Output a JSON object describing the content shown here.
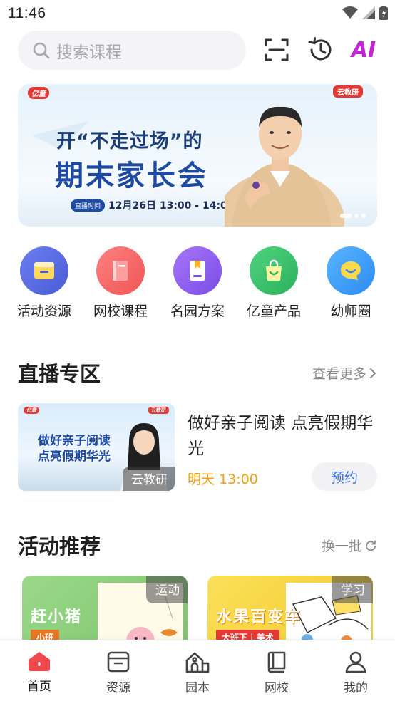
{
  "status_bar": {
    "time": "11:46"
  },
  "search": {
    "placeholder": "搜索课程"
  },
  "header": {
    "ai_label": "AI"
  },
  "banner": {
    "brand_left": "亿童",
    "brand_right": "云教研",
    "line1": "开“不走过场”的",
    "line2": "期末家长会",
    "live_tag": "直播时间",
    "live_time": "12月26日 13:00 - 14:00"
  },
  "quick_menu": [
    {
      "label": "活动资源",
      "color": "#5b6ee1",
      "icon": "folder-icon"
    },
    {
      "label": "网校课程",
      "color": "#f26b6b",
      "icon": "book-icon"
    },
    {
      "label": "名园方案",
      "color": "#8b5cf6",
      "icon": "bookmark-icon"
    },
    {
      "label": "亿童产品",
      "color": "#34c36a",
      "icon": "shopping-bag-icon"
    },
    {
      "label": "幼师圈",
      "color": "#3b9ff5",
      "icon": "chat-bubble-icon"
    }
  ],
  "live_section": {
    "title": "直播专区",
    "more": "查看更多",
    "item": {
      "thumb_brand_left": "亿童",
      "thumb_brand_right": "云教研",
      "thumb_line1": "做好亲子阅读",
      "thumb_line2": "点亮假期华光",
      "thumb_badge": "云教研",
      "title": "做好亲子阅读 点亮假期华光",
      "time": "明天 13:00",
      "button": "预约"
    }
  },
  "activity_section": {
    "title": "活动推荐",
    "refresh": "换一批",
    "cards": [
      {
        "title": "赶小猪",
        "sub": "小班",
        "tag": "运动",
        "color": "#8bd07a"
      },
      {
        "title": "水果百变车",
        "sub": "大班下 | 美术",
        "tag": "学习",
        "color": "#f7d84a"
      }
    ]
  },
  "bottom_nav": [
    {
      "label": "首页",
      "icon": "home-icon",
      "active": true
    },
    {
      "label": "资源",
      "icon": "box-icon",
      "active": false
    },
    {
      "label": "园本",
      "icon": "school-icon",
      "active": false
    },
    {
      "label": "网校",
      "icon": "book-icon",
      "active": false
    },
    {
      "label": "我的",
      "icon": "user-icon",
      "active": false
    }
  ],
  "colors": {
    "accent": "#f0484f",
    "orange": "#f59e0b",
    "link": "#3b6fd8",
    "ai": "#c026d3"
  }
}
